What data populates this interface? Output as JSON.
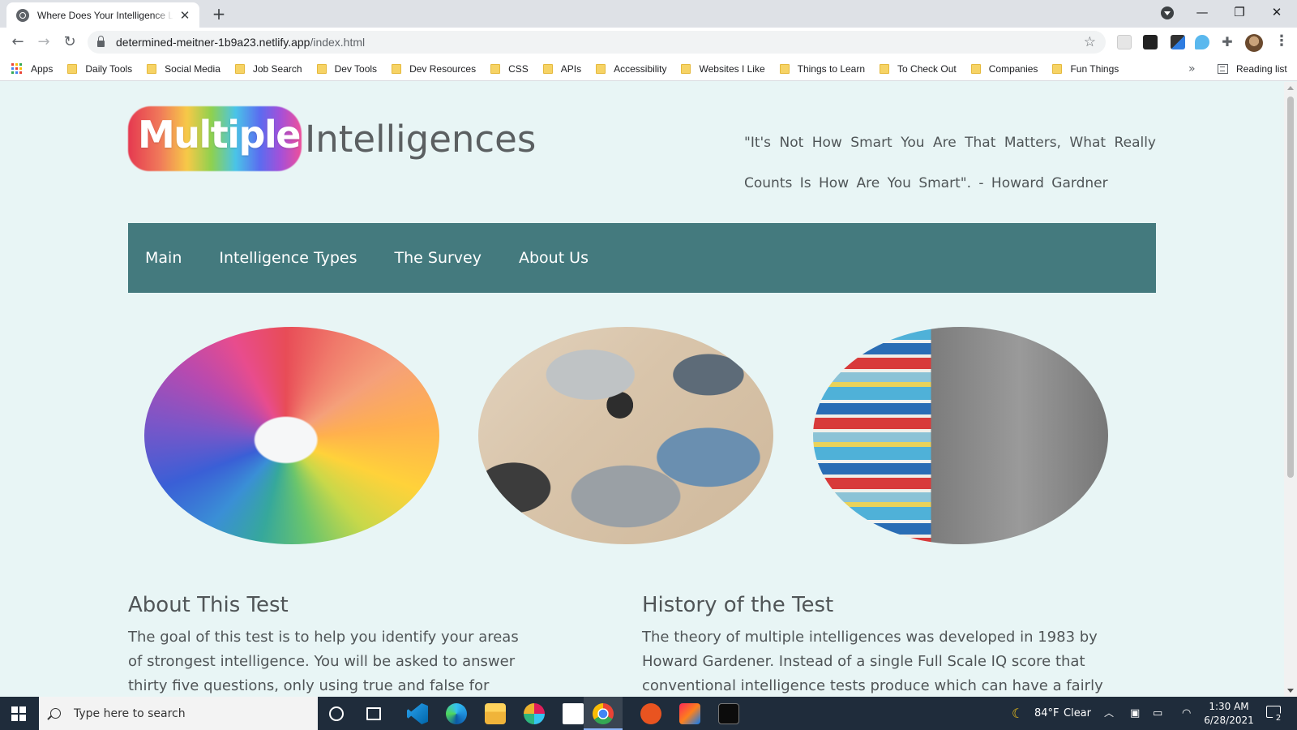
{
  "browser": {
    "tab_title": "Where Does Your Intelligence Lie?",
    "new_tab_symbol": "+",
    "close_symbol": "✕",
    "url_domain": "determined-meitner-1b9a23.netlify.app",
    "url_path": "/index.html",
    "window_controls": {
      "minimize": "—",
      "restore": "❐",
      "close": "✕"
    }
  },
  "bookmarks": {
    "apps_label": "Apps",
    "items": [
      "Daily Tools",
      "Social Media",
      "Job Search",
      "Dev Tools",
      "Dev Resources",
      "CSS",
      "APIs",
      "Accessibility",
      "Websites I Like",
      "Things to Learn",
      "To Check Out",
      "Companies",
      "Fun Things"
    ],
    "overflow_symbol": "»",
    "reading_list_label": "Reading list",
    "folder_color": "#f6d365"
  },
  "site": {
    "logo_word_1": "Multiple",
    "logo_word_2": "Intelligences",
    "quote": "\"It's Not How Smart You Are That Matters, What Really Counts Is How Are You Smart\". - Howard Gardner",
    "nav": [
      "Main",
      "Intelligence Types",
      "The Survey",
      "About Us"
    ],
    "nav_color": "#447a7e",
    "background_color": "#e8f5f5",
    "images": [
      "colored-pencils-photo",
      "desk-laptops-photo",
      "book-stack-photo"
    ],
    "about": {
      "heading": "About This Test",
      "body": "The goal of this test is to help you identify your areas of strongest intelligence. You will be asked to answer thirty five questions, only using true and false for each"
    },
    "history": {
      "heading": "History of the Test",
      "body": "The theory of multiple intelligences was developed in 1983 by Howard Gardener. Instead of a single Full Scale IQ score that conventional intelligence tests produce which can have a fairly narrow and specific"
    }
  },
  "taskbar": {
    "search_placeholder": "Type here to search",
    "weather_temp": "84°F",
    "weather_desc": "Clear",
    "time": "1:30 AM",
    "date": "6/28/2021",
    "notification_count": "2"
  }
}
